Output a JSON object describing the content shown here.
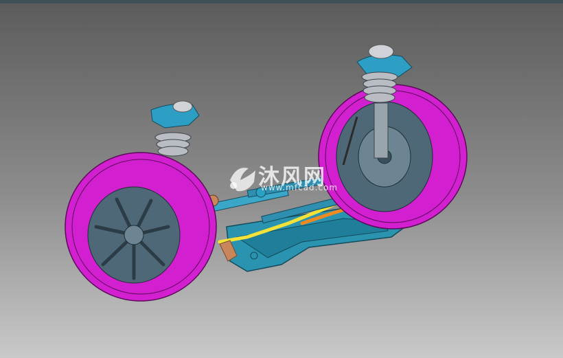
{
  "scene": {
    "description_label": "",
    "background_top": "#5b5b5b",
    "background_bottom": "#c9c9c9"
  },
  "colors": {
    "tire": "#d21fd0",
    "tire_dark": "#9d149b",
    "rim": "#4f6878",
    "subframe": "#2a93b0",
    "strut_mount": "#2e9fc4",
    "spring": "#b9bcc2",
    "yellow_line": "#f3e23a",
    "orange_line": "#f08a1e",
    "copper": "#c9865a",
    "damper": "#9aa4ac"
  },
  "watermark": {
    "brand": "沐风网",
    "url": "www.mfcad.com",
    "logo_icon": "mf-logo-icon"
  }
}
